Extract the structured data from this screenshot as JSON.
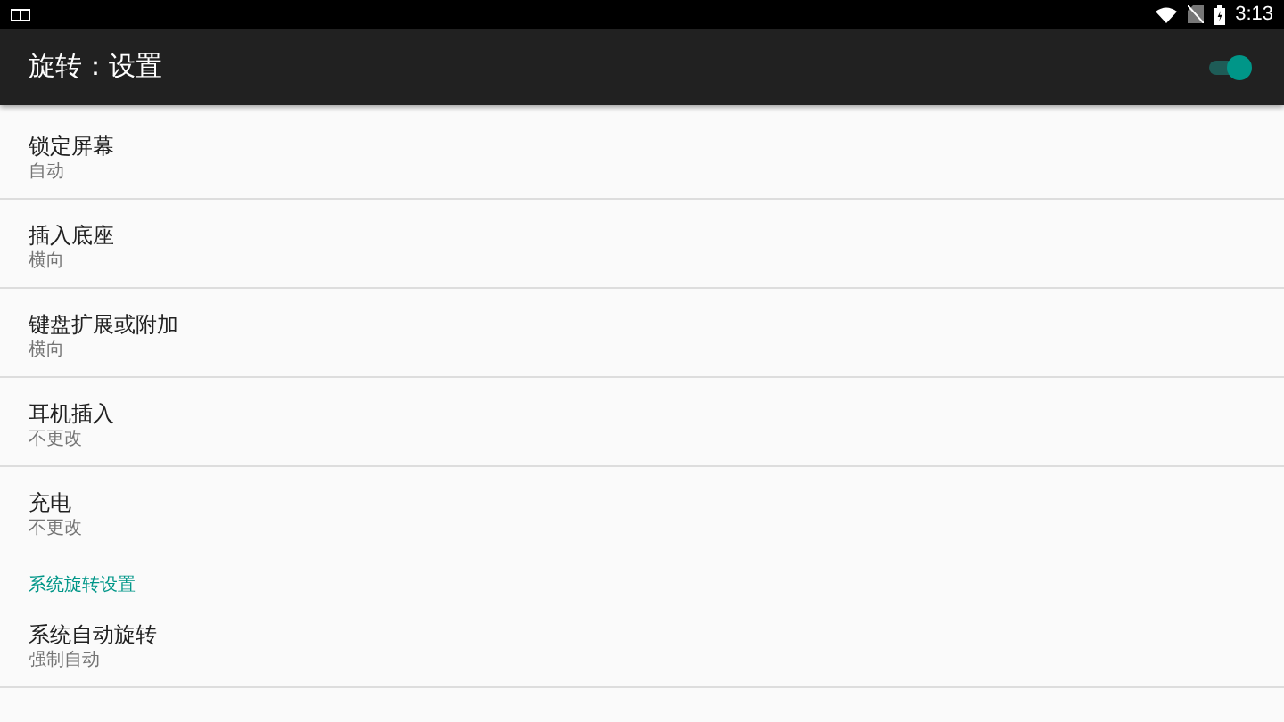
{
  "status_bar": {
    "time": "3:13"
  },
  "app_bar": {
    "title": "旋转：设置",
    "switch": {
      "on": true
    }
  },
  "sections": [
    {
      "items": [
        {
          "title": "锁定屏幕",
          "summary": "自动"
        },
        {
          "title": "插入底座",
          "summary": "横向"
        },
        {
          "title": "键盘扩展或附加",
          "summary": "横向"
        },
        {
          "title": "耳机插入",
          "summary": "不更改"
        },
        {
          "title": "充电",
          "summary": "不更改"
        }
      ]
    },
    {
      "header": "系统旋转设置",
      "items": [
        {
          "title": "系统自动旋转",
          "summary": "强制自动"
        }
      ]
    }
  ]
}
